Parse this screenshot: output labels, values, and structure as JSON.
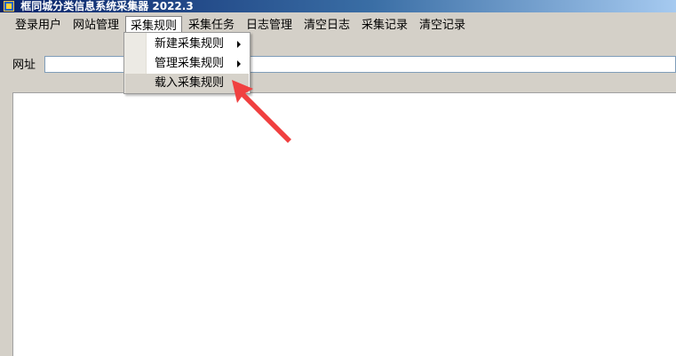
{
  "window": {
    "title": "框同城分类信息系统采集器 2022.3"
  },
  "menubar": {
    "items": [
      "登录用户",
      "网站管理",
      "采集规则",
      "采集任务",
      "日志管理",
      "清空日志",
      "采集记录",
      "清空记录"
    ]
  },
  "dropdown": {
    "items": [
      {
        "label": "新建采集规则",
        "has_submenu": true
      },
      {
        "label": "管理采集规则",
        "has_submenu": true
      },
      {
        "label": "载入采集规则",
        "has_submenu": false
      }
    ]
  },
  "url_bar": {
    "label": "网址",
    "value": ""
  },
  "annotation": {
    "arrow_color": "#f04040",
    "icon": "red-pointer-arrow"
  }
}
